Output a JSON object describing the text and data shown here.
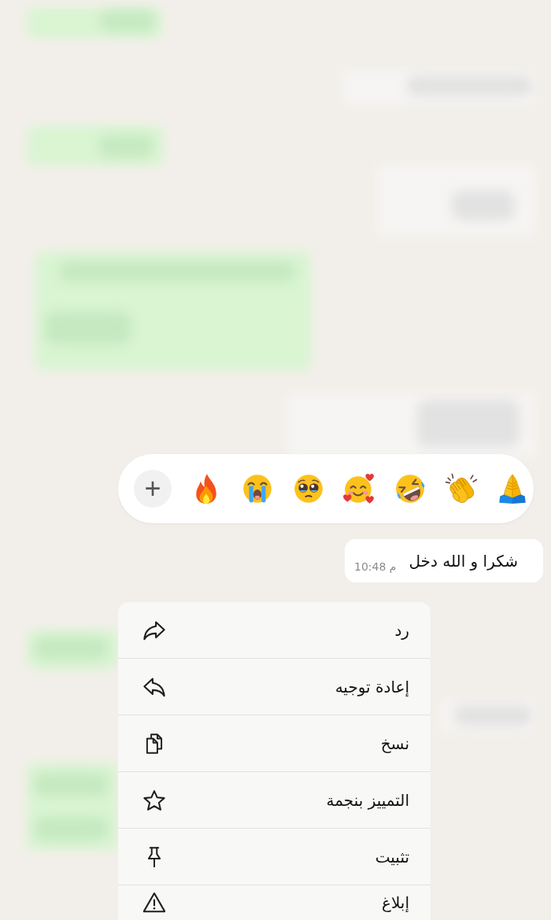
{
  "background_messages": [
    {
      "kind": "sent"
    },
    {
      "kind": "received"
    },
    {
      "kind": "sent"
    },
    {
      "kind": "received"
    },
    {
      "kind": "sent"
    },
    {
      "kind": "received"
    },
    {
      "kind": "sent"
    },
    {
      "kind": "received"
    },
    {
      "kind": "sent"
    }
  ],
  "reaction_bar": {
    "reactions": [
      {
        "kind": "pray"
      },
      {
        "kind": "clap"
      },
      {
        "kind": "rofl"
      },
      {
        "kind": "hearts"
      },
      {
        "kind": "pleading"
      },
      {
        "kind": "sob"
      },
      {
        "kind": "fire"
      }
    ],
    "more_button": "+"
  },
  "message": {
    "text": "شكرا و الله دخل",
    "time": "10:48 م"
  },
  "context_menu": {
    "items": [
      {
        "label": "رد",
        "kind": "reply"
      },
      {
        "label": "إعادة توجيه",
        "kind": "forward"
      },
      {
        "label": "نسخ",
        "kind": "copy"
      },
      {
        "label": "التمييز بنجمة",
        "kind": "star"
      },
      {
        "label": "تثبيت",
        "kind": "pin"
      },
      {
        "label": "إبلاغ",
        "kind": "report"
      }
    ]
  }
}
